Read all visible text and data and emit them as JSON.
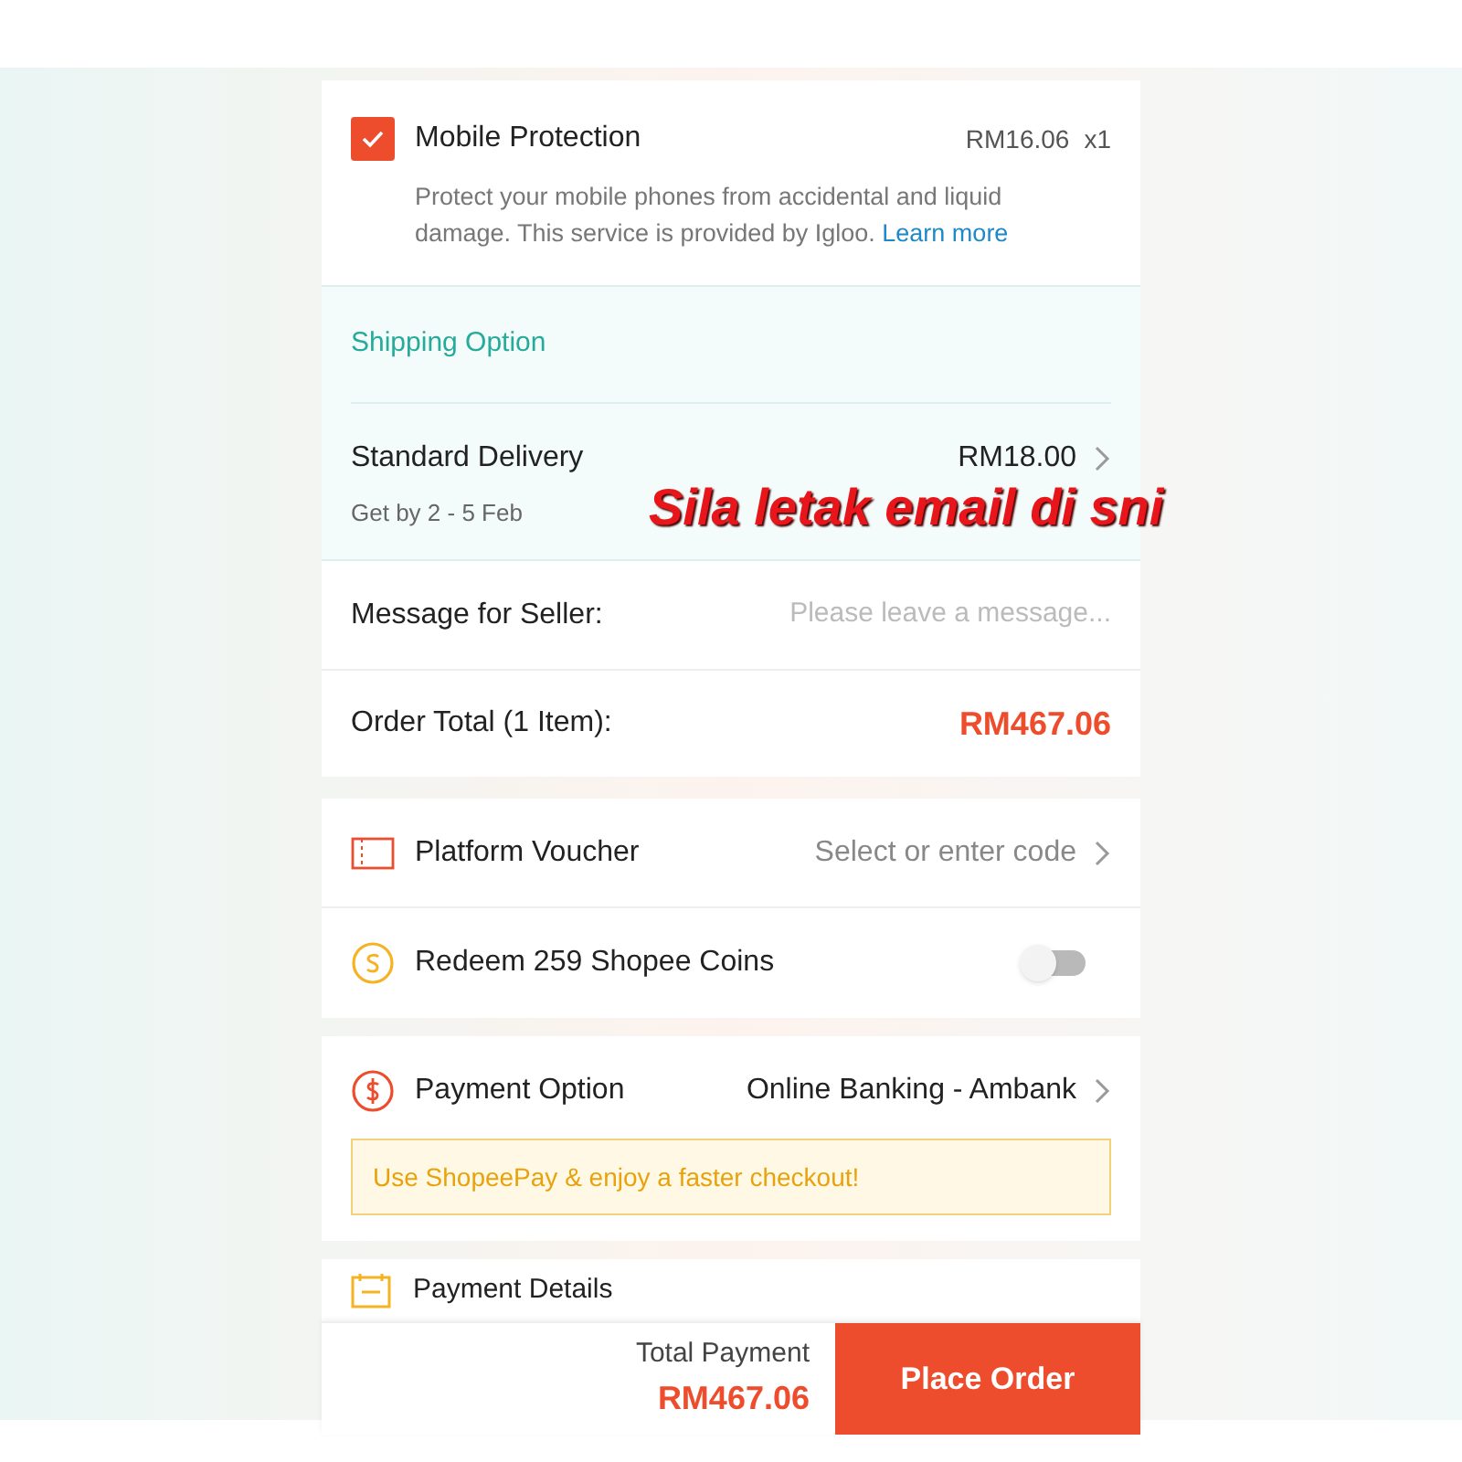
{
  "protection": {
    "checked": true,
    "title": "Mobile Protection",
    "price": "RM16.06",
    "quantity": "x1",
    "description": "Protect your mobile phones from accidental and liquid damage. This service is provided by Igloo.",
    "link": "Learn more"
  },
  "shipping": {
    "heading": "Shipping Option",
    "method": "Standard Delivery",
    "price": "RM18.00",
    "eta": "Get by 2 - 5 Feb"
  },
  "overlay_note": "Sila letak email di sni",
  "message": {
    "label": "Message for Seller:",
    "placeholder": "Please leave a message..."
  },
  "order_total": {
    "label": "Order Total (1 Item):",
    "value": "RM467.06"
  },
  "voucher": {
    "label": "Platform Voucher",
    "value": "Select or enter code"
  },
  "coins": {
    "label": "Redeem 259 Shopee Coins",
    "on": false
  },
  "payment": {
    "label": "Payment Option",
    "value": "Online Banking - Ambank",
    "banner": "Use ShopeePay & enjoy a faster checkout!"
  },
  "payment_details": {
    "label": "Payment Details"
  },
  "footer": {
    "total_label": "Total Payment",
    "total": "RM467.06",
    "button": "Place Order"
  }
}
